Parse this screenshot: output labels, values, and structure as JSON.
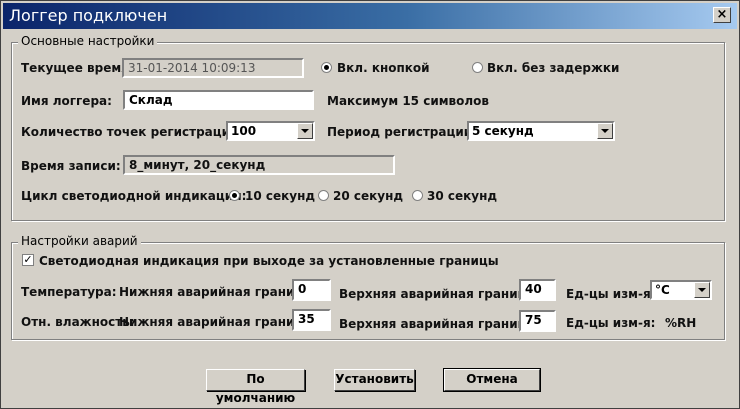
{
  "window": {
    "title": "Логгер подключен",
    "close_glyph": "×"
  },
  "main_group": {
    "legend": "Основные настройки",
    "current_time_label": "Текущее время:",
    "current_time_value": "31-01-2014 10:09:13",
    "radio_button_start": "Вкл. кнопкой",
    "radio_no_delay": "Вкл. без задержки",
    "logger_name_label": "Имя логгера:",
    "logger_name_value": "Склад",
    "max_chars_note": "Максимум 15 символов",
    "points_label": "Количество точек регистрации:",
    "points_value": "100",
    "period_label": "Период регистрации:",
    "period_value": "5 секунд",
    "record_time_label": "Время записи:",
    "record_time_value": "8_минут, 20_секунд",
    "led_cycle_label": "Цикл светодиодной индикации:",
    "led_options": [
      "10 секунд",
      "20 секунд",
      "30 секунд"
    ],
    "led_selected": 0
  },
  "alarm_group": {
    "legend": "Настройки аварий",
    "led_alarm_checkbox": "Светодиодная индикация при выходе за установленные границы",
    "led_alarm_checked": true,
    "check_glyph": "✓",
    "temperature": {
      "label": "Температура:",
      "lower_label": "Нижняя аварийная граница",
      "lower_value": "0",
      "upper_label": "Верхняя аварийная граница",
      "upper_value": "40",
      "units_label": "Ед-цы изм-я:",
      "units_value": "°C"
    },
    "humidity": {
      "label": "Отн. влажность:",
      "lower_label": "Нижняя аварийная граница",
      "lower_value": "35",
      "upper_label": "Верхняя аварийная граница",
      "upper_value": "75",
      "units_label": "Ед-цы изм-я:",
      "units_value": "%RH"
    }
  },
  "buttons": {
    "defaults": "По умолчанию",
    "apply": "Установить",
    "cancel": "Отмена"
  }
}
